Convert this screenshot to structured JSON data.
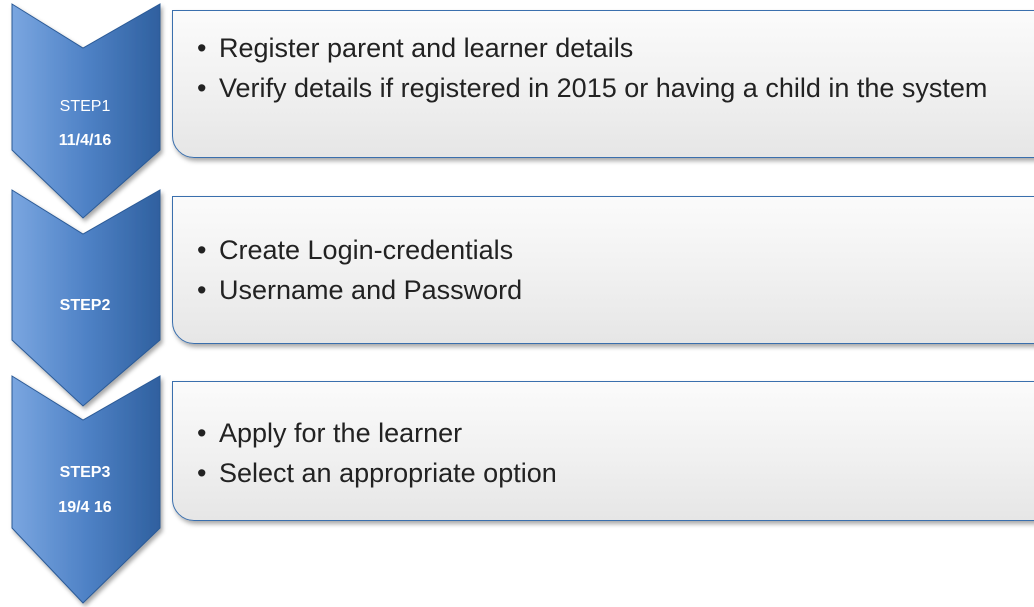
{
  "steps": [
    {
      "label": "STEP1",
      "date": "11/4/16",
      "bullets": [
        "Register parent and learner details",
        "Verify details if registered in 2015 or having a child in the system"
      ]
    },
    {
      "label": "STEP2",
      "date": "",
      "bullets": [
        "Create Login-credentials",
        "Username and Password"
      ]
    },
    {
      "label": "STEP3",
      "date": "19/4 16",
      "bullets": [
        "Apply for the learner",
        "Select an appropriate option"
      ]
    }
  ],
  "bullet_char": "•",
  "colors": {
    "chevron_light": "#6d9ad6",
    "chevron_dark": "#2e5f9e",
    "box_border": "#3a6fad",
    "text": "#222222"
  }
}
